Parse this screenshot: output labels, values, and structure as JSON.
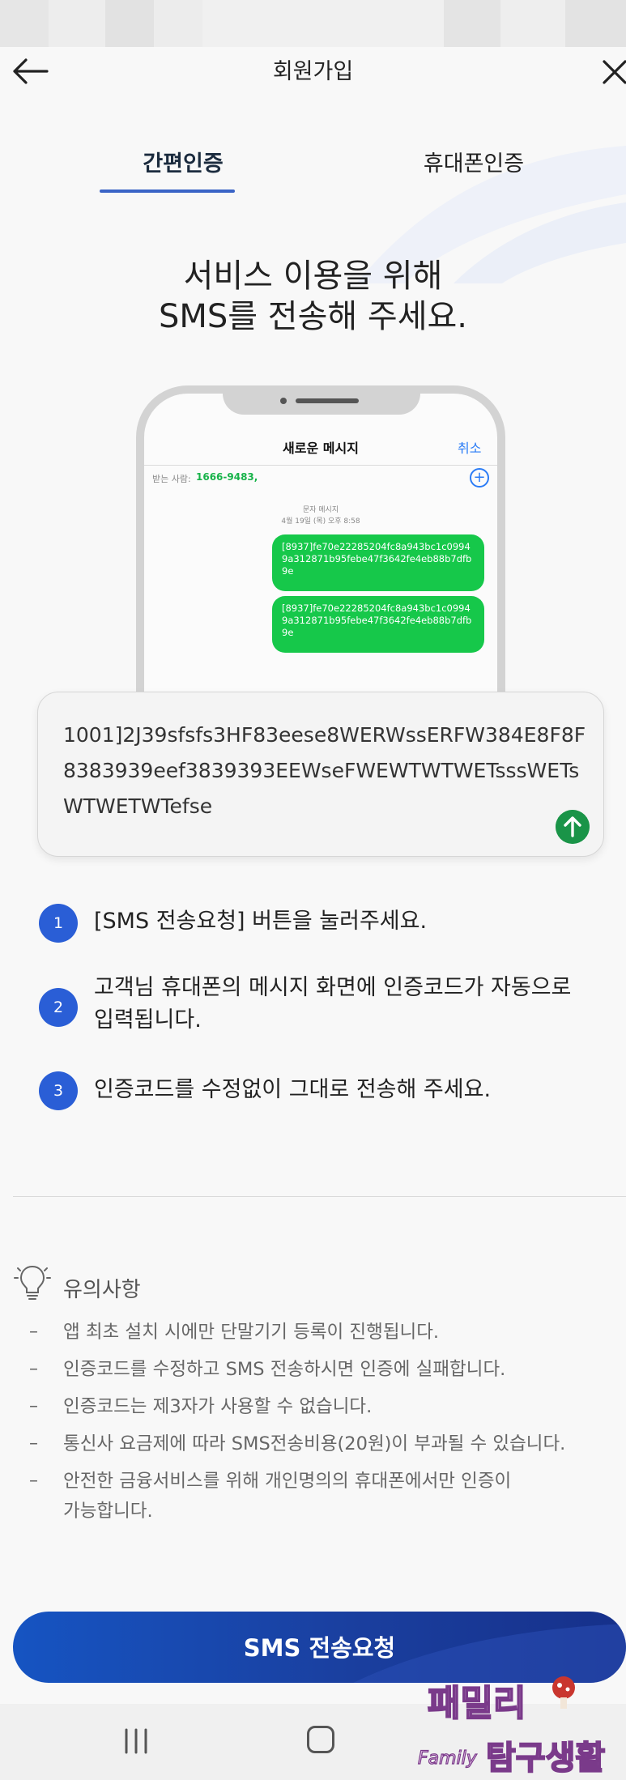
{
  "header": {
    "title": "회원가입"
  },
  "tabs": [
    {
      "label": "간편인증",
      "active": true
    },
    {
      "label": "휴대폰인증",
      "active": false
    }
  ],
  "headline": {
    "line1": "서비스 이용을 위해",
    "line2": "SMS를 전송해 주세요."
  },
  "phone_mock": {
    "title": "새로운 메시지",
    "cancel": "취소",
    "to_label": "받는 사람:",
    "to_number": "1666-9483,",
    "meta_line1": "문자 메시지",
    "meta_line2": "4월 19일 (목) 오후 8:58",
    "bubbles": [
      "[8937]fe70e22285204fc8a943bc1c09949a312871b95febe47f3642fe4eb88b7dfb9e",
      "[8937]fe70e22285204fc8a943bc1c09949a312871b95febe47f3642fe4eb88b7dfb9e"
    ]
  },
  "sms_code": {
    "line1": "1001]2J39sfsfs3HF83eese8WERWssERFW384E8F8F",
    "line2": "8383939eef3839393EEWseFWEWTWTWETsssWETs",
    "line3": "WTWETWTefse"
  },
  "steps": [
    {
      "num": "1",
      "line1": "[SMS 전송요청] 버튼을 눌러주세요.",
      "line2": ""
    },
    {
      "num": "2",
      "line1": "고객님 휴대폰의 메시지 화면에 인증코드가 자동으로",
      "line2": "입력됩니다."
    },
    {
      "num": "3",
      "line1": "인증코드를 수정없이 그대로 전송해 주세요.",
      "line2": ""
    }
  ],
  "notes": {
    "title": "유의사항",
    "dash": "–",
    "items": [
      {
        "line1": "앱 최초 설치 시에만 단말기기 등록이 진행됩니다.",
        "line2": ""
      },
      {
        "line1": "인증코드를 수정하고 SMS 전송하시면 인증에 실패합니다.",
        "line2": ""
      },
      {
        "line1": "인증코드는 제3자가 사용할 수 없습니다.",
        "line2": ""
      },
      {
        "line1": "통신사 요금제에 따라 SMS전송비용(20원)이 부과될 수 있습니다.",
        "line2": ""
      },
      {
        "line1": "안전한 금융서비스를 위해 개인명의의 휴대폰에서만 인증이",
        "line2": "가능합니다."
      }
    ]
  },
  "cta": {
    "label": "SMS 전송요청"
  },
  "colors": {
    "accent": "#3a64c6",
    "step_badge": "#2a5ed6",
    "bubble": "#16c84a",
    "send": "#1a9448",
    "cta_start": "#1654c2",
    "cta_end": "#16308a"
  },
  "watermark": {
    "line1": "패밀리",
    "line2": "Family 탐구생활"
  }
}
